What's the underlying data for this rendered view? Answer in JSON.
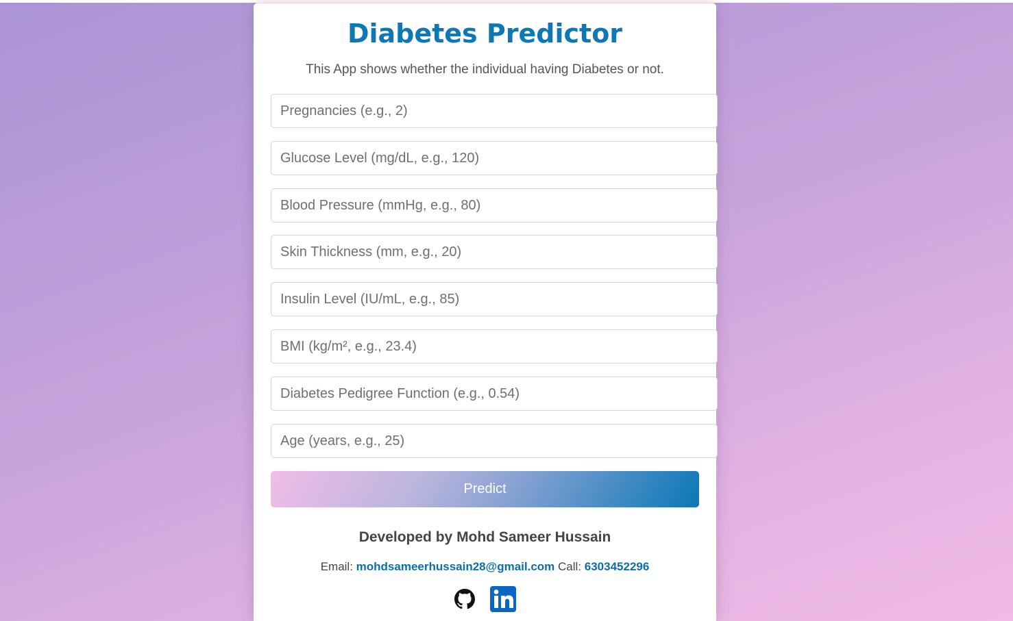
{
  "header": {
    "title": "Diabetes Predictor",
    "subtitle": "This App shows whether the individual having Diabetes or not."
  },
  "form": {
    "fields": [
      {
        "placeholder": "Pregnancies (e.g., 2)",
        "value": ""
      },
      {
        "placeholder": "Glucose Level (mg/dL, e.g., 120)",
        "value": ""
      },
      {
        "placeholder": "Blood Pressure (mmHg, e.g., 80)",
        "value": ""
      },
      {
        "placeholder": "Skin Thickness (mm, e.g., 20)",
        "value": ""
      },
      {
        "placeholder": "Insulin Level (IU/mL, e.g., 85)",
        "value": ""
      },
      {
        "placeholder": "BMI (kg/m², e.g., 23.4)",
        "value": ""
      },
      {
        "placeholder": "Diabetes Pedigree Function (e.g., 0.54)",
        "value": ""
      },
      {
        "placeholder": "Age (years, e.g., 25)",
        "value": ""
      }
    ],
    "submit_label": "Predict"
  },
  "footer": {
    "developer": "Developed by Mohd Sameer Hussain",
    "email_label": "Email:",
    "email": "mohdsameerhussain28@gmail.com",
    "call_label": "Call:",
    "phone": "6303452296",
    "icons": [
      "github-icon",
      "linkedin-icon"
    ]
  },
  "colors": {
    "accent": "#0e78b5",
    "link": "#0e6ea8",
    "linkedin": "#0a66c2"
  }
}
